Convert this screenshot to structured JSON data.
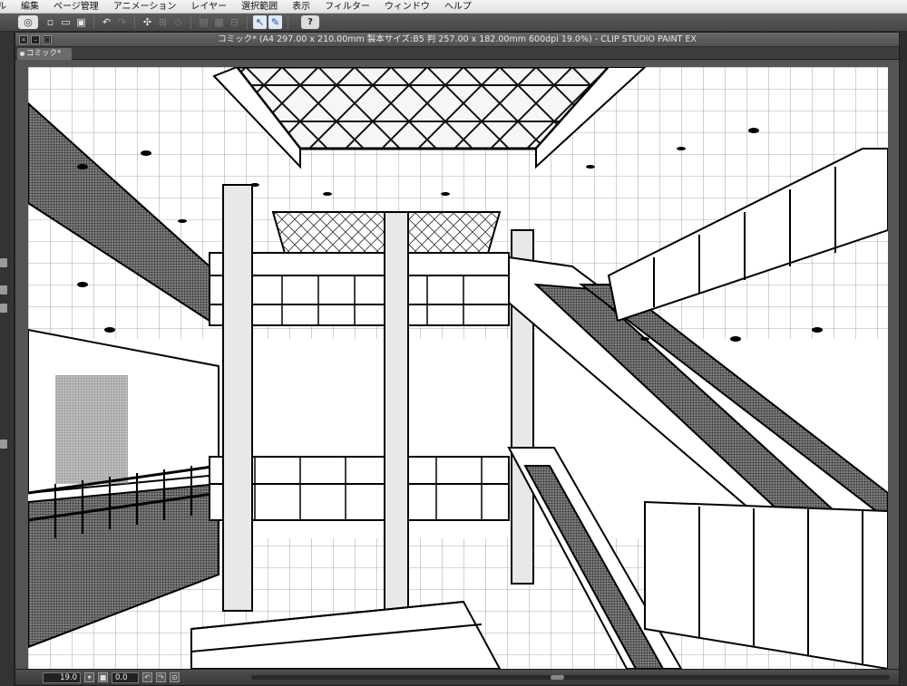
{
  "menu": {
    "items": [
      "ル",
      "編集",
      "ページ管理",
      "アニメーション",
      "レイヤー",
      "選択範囲",
      "表示",
      "フィルター",
      "ウィンドウ",
      "ヘルプ"
    ]
  },
  "toolbar": {
    "icons": [
      "logo-icon",
      "new-icon",
      "open-icon",
      "save-icon",
      "undo-icon",
      "redo-icon",
      "transform-icon",
      "select-icon",
      "lasso-icon",
      "fill-icon",
      "ruler-icon",
      "perspective-icon",
      "snap-icon",
      "help-icon"
    ],
    "help_label": "?"
  },
  "document": {
    "title": "コミック* (A4 297.00 x 210.00mm 製本サイズ:B5 判 257.00 x 182.00mm 600dpi 19.0%) - CLIP STUDIO PAINT EX",
    "tab_label": "コミック*"
  },
  "status": {
    "zoom": "19.0",
    "angle": "0.0"
  },
  "colors": {
    "chrome": "#4b4b4b",
    "menubar": "#ececec",
    "accent_blue": "#1c4c9e"
  }
}
